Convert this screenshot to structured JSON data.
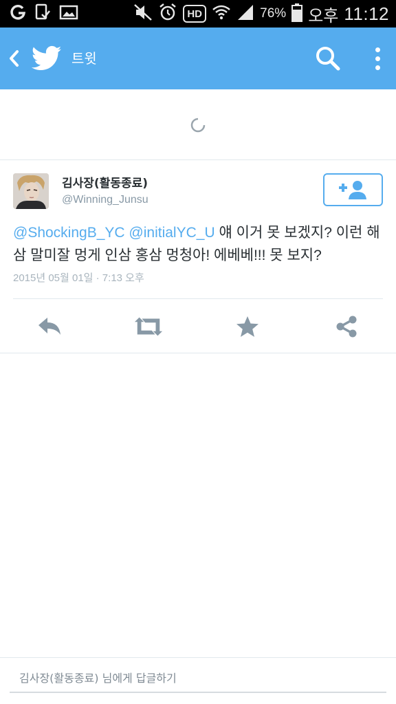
{
  "status_bar": {
    "icons_left": [
      "carrier-g-icon",
      "tablet-check-icon",
      "gallery-icon"
    ],
    "icons_right": [
      "mute-icon",
      "alarm-icon",
      "hd-voice-icon",
      "wifi-icon",
      "signal-icon",
      "battery-icon"
    ],
    "hd_label": "HD",
    "battery_percent": "76%",
    "ampm": "오후",
    "time": "11:12"
  },
  "app_bar": {
    "title": "트윗",
    "background_color": "#55acee",
    "icons": [
      "back-icon",
      "twitter-bird-icon",
      "search-icon",
      "overflow-menu-icon"
    ]
  },
  "tweet": {
    "display_name": "김사장(활동종료)",
    "handle": "@Winning_Junsu",
    "follow_icon": "follow-user-icon",
    "mention_1": "@ShockingB_YC",
    "mention_2": "@initialYC_U",
    "body_text": "얘 이거 못 보겠지? 이런 해삼 말미잘 멍게 인삼 홍삼 멍청아! 에베베!!! 못 보지?",
    "timestamp": "2015년 05월 01일 · 7:13 오후",
    "accent_color": "#55acee"
  },
  "actions": {
    "icons": [
      "reply-icon",
      "retweet-icon",
      "favorite-star-icon",
      "share-icon"
    ]
  },
  "reply": {
    "placeholder": "김사장(활동종료) 님에게 답글하기"
  }
}
